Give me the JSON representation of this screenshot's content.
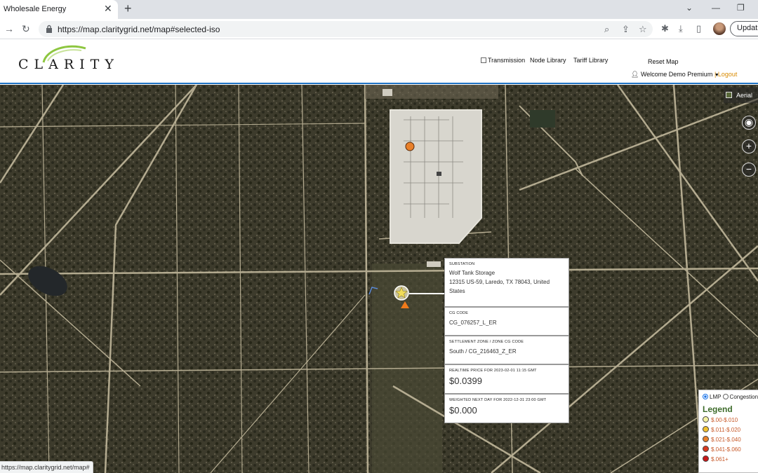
{
  "browser": {
    "tab_title": "Wholesale Energy",
    "url": "https://map.claritygrid.net/map#selected-iso",
    "update_label": "Update",
    "status_url": "https://map.claritygrid.net/map#"
  },
  "header": {
    "logo_text": "CLARITY",
    "transmission_label": "Transmission",
    "node_library_label": "Node Library",
    "tariff_library_label": "Tariff Library",
    "reset_map_label": "Reset Map",
    "welcome_label": "Welcome Demo Premium",
    "logout_label": "Logout"
  },
  "map": {
    "layer_label": "Aerial",
    "locate_icon": "target-icon",
    "zoom_in": "+",
    "zoom_out": "−"
  },
  "info": {
    "substation_label": "SUBSTATION",
    "substation_name": "Wolf Tank Storage",
    "substation_address": "12315 US-59, Laredo, TX 78043, United States",
    "cg_code_label": "CG CODE",
    "cg_code": "CG_076257_L_ER",
    "zone_label": "SETTLEMENT ZONE / ZONE CG CODE",
    "zone_value": "South / CG_216463_Z_ER",
    "realtime_label": "REALTIME PRICE FOR 2023-02-01 11:15 GMT",
    "realtime_value": "$0.0399",
    "nextday_label": "WEIGHTED NEXT DAY FOR 2022-12-31 23:00 GMT",
    "nextday_value": "$0.000"
  },
  "legend": {
    "lmp_label": "LMP",
    "congestion_label": "Congestion",
    "title": "Legend",
    "items": [
      {
        "label": "$.00-$.010",
        "color": "#f3f0a0"
      },
      {
        "label": "$.011-$.020",
        "color": "#f0c030"
      },
      {
        "label": "$.021-$.040",
        "color": "#e8802a"
      },
      {
        "label": "$.041-$.060",
        "color": "#d83a20"
      },
      {
        "label": "$.061+",
        "color": "#c81818"
      }
    ]
  }
}
